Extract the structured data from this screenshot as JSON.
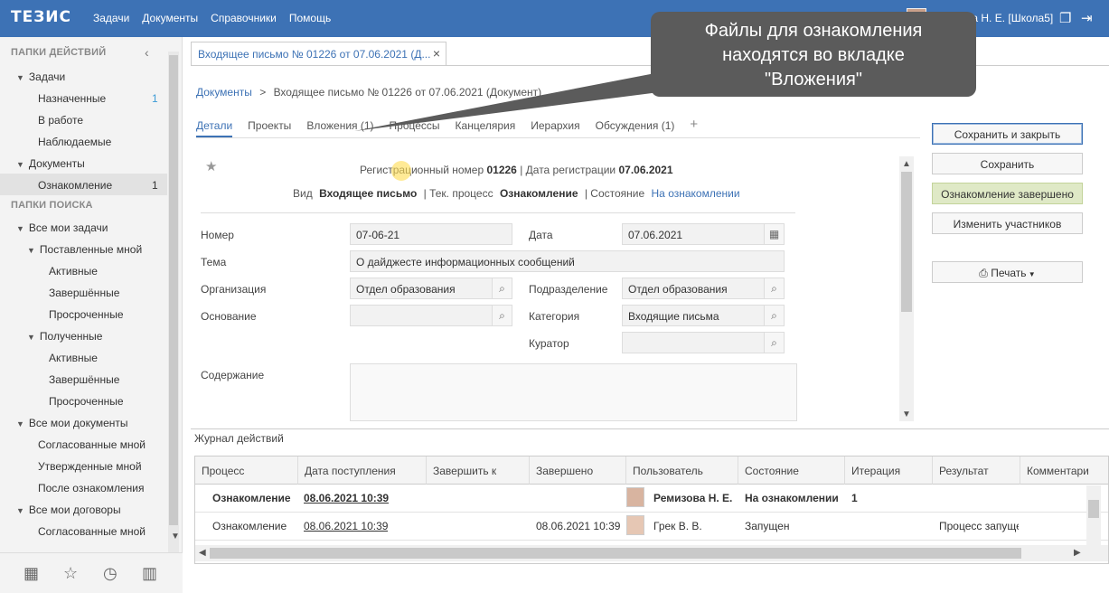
{
  "topbar": {
    "logo": "ТЕЗИС",
    "menu": [
      "Задачи",
      "Документы",
      "Справочники",
      "Помощь"
    ],
    "user": "Ремизова Н. Е. [Школа5]"
  },
  "sidebar": {
    "actions_header": "ПАПКИ ДЕЙСТВИЙ",
    "search_header": "ПАПКИ ПОИСКА",
    "items": [
      {
        "label": "Задачи",
        "count": ""
      },
      {
        "label": "Назначенные",
        "count": "1"
      },
      {
        "label": "В работе",
        "count": ""
      },
      {
        "label": "Наблюдаемые",
        "count": ""
      },
      {
        "label": "Документы",
        "count": ""
      },
      {
        "label": "Ознакомление",
        "count": "1"
      },
      {
        "label": "Все мои задачи",
        "count": ""
      },
      {
        "label": "Поставленные мной",
        "count": ""
      },
      {
        "label": "Активные",
        "count": ""
      },
      {
        "label": "Завершённые",
        "count": ""
      },
      {
        "label": "Просроченные",
        "count": ""
      },
      {
        "label": "Полученные",
        "count": ""
      },
      {
        "label": "Активные",
        "count": ""
      },
      {
        "label": "Завершённые",
        "count": ""
      },
      {
        "label": "Просроченные",
        "count": ""
      },
      {
        "label": "Все мои документы",
        "count": ""
      },
      {
        "label": "Согласованные мной",
        "count": ""
      },
      {
        "label": "Утвержденные мной",
        "count": ""
      },
      {
        "label": "После ознакомления",
        "count": ""
      },
      {
        "label": "Все мои договоры",
        "count": ""
      },
      {
        "label": "Согласованные мной",
        "count": ""
      }
    ]
  },
  "doc_tab": "Входящее письмо № 01226 от 07.06.2021 (Д...",
  "breadcrumb": {
    "root": "Документы",
    "sep": ">",
    "current": "Входящее письмо № 01226 от 07.06.2021 (Документ)"
  },
  "subtabs": [
    "Детали",
    "Проекты",
    "Вложения (1)",
    "Процессы",
    "Канцелярия",
    "Иерархия",
    "Обсуждения (1)",
    "+"
  ],
  "tooltip": {
    "line1": "Файлы для ознакомления",
    "line2": "находятся во вкладке",
    "line3": "\"Вложения\""
  },
  "header": {
    "reg_label": "Регистрационный номер",
    "reg_number": "01226",
    "reg_date_label": "| Дата регистрации",
    "reg_date": "07.06.2021",
    "kind_label": "Вид",
    "kind": "Входящее письмо",
    "process_label": "| Тек. процесс",
    "process": "Ознакомление",
    "state_label": "| Состояние",
    "state": "На ознакомлении"
  },
  "form": {
    "number_label": "Номер",
    "number": "07-06-21",
    "date_label": "Дата",
    "date": "07.06.2021",
    "subject_label": "Тема",
    "subject": "О дайджесте информационных сообщений",
    "org_label": "Организация",
    "org": "Отдел образования",
    "division_label": "Подразделение",
    "division": "Отдел образования",
    "basis_label": "Основание",
    "basis": "",
    "category_label": "Категория",
    "category": "Входящие письма",
    "curator_label": "Куратор",
    "curator": "",
    "content_label": "Содержание"
  },
  "actions": {
    "save_close": "Сохранить и закрыть",
    "save": "Сохранить",
    "done": "Ознакомление завершено",
    "change": "Изменить участников",
    "print": "Печать"
  },
  "journal": {
    "title": "Журнал действий",
    "columns": [
      "Процесс",
      "Дата поступления",
      "Завершить к",
      "Завершено",
      "Пользователь",
      "Состояние",
      "Итерация",
      "Результат",
      "Комментари"
    ],
    "rows": [
      {
        "process": "Ознакомление",
        "date": "08.06.2021 10:39",
        "due": "",
        "finished": "",
        "user": "Ремизова Н. Е.",
        "state": "На ознакомлении",
        "iteration": "1",
        "result": "",
        "comment": ""
      },
      {
        "process": "Ознакомление",
        "date": "08.06.2021 10:39",
        "due": "",
        "finished": "08.06.2021 10:39",
        "user": "Грек В. В.",
        "state": "Запущен",
        "iteration": "",
        "result": "Процесс запуще",
        "comment": ""
      }
    ]
  }
}
